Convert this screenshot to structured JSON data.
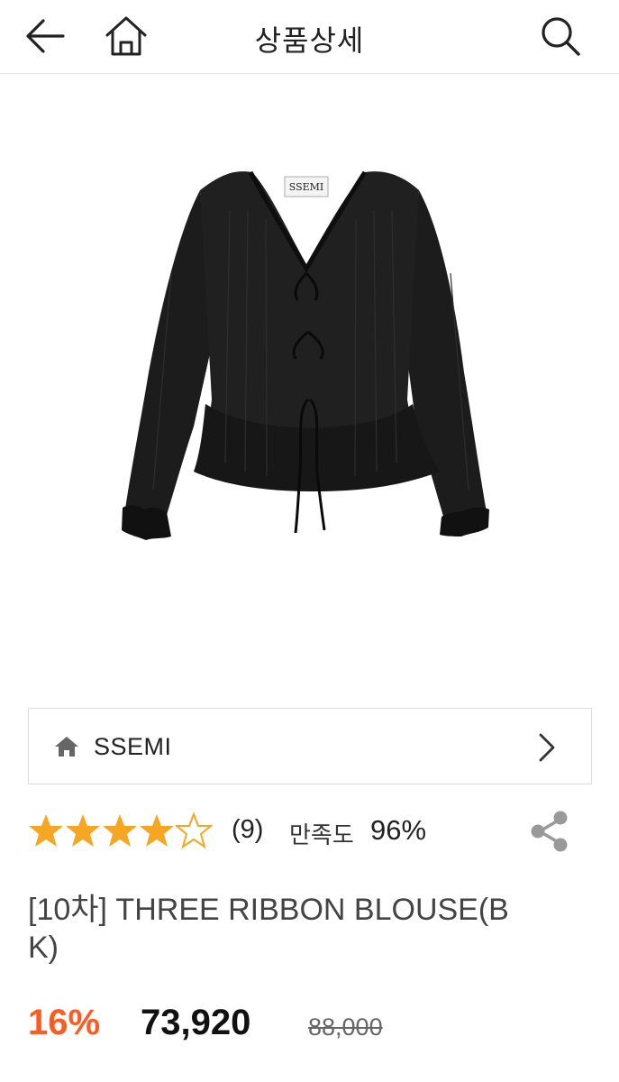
{
  "header": {
    "title": "상품상세",
    "back_icon": "arrow-left-icon",
    "home_icon": "home-icon",
    "search_icon": "search-icon"
  },
  "product_image": {
    "brand_tag": "SSEMI",
    "alt": "black blouse"
  },
  "brand": {
    "name": "SSEMI",
    "icon": "home-icon",
    "chevron": "chevron-right-icon"
  },
  "rating": {
    "stars": 4,
    "max_stars": 5,
    "star_color": "#f5a623",
    "review_count": "(9)",
    "satisfaction_label": "만족도",
    "satisfaction_value": "96%"
  },
  "product": {
    "name": "[10차] THREE RIBBON BLOUSE(BK)"
  },
  "price": {
    "discount": "16%",
    "sale_price": "73,920",
    "original_price": "88,000",
    "discount_color": "#ff5a1f"
  }
}
